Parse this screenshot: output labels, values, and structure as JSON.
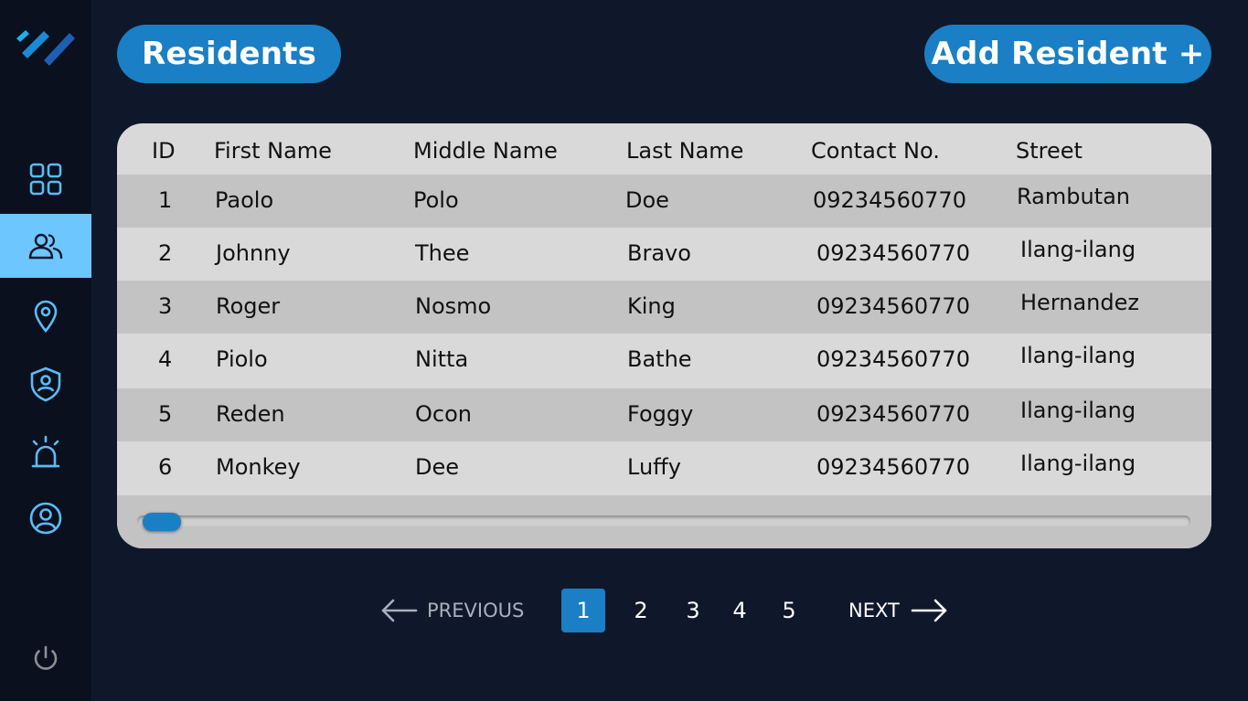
{
  "header": {
    "title": "Residents",
    "add_button": "Add Resident +"
  },
  "sidebar": {
    "items": [
      {
        "icon": "grid-icon",
        "active": false
      },
      {
        "icon": "users-icon",
        "active": true
      },
      {
        "icon": "map-pin-icon",
        "active": false
      },
      {
        "icon": "shield-user-icon",
        "active": false
      },
      {
        "icon": "alarm-icon",
        "active": false
      },
      {
        "icon": "user-circle-icon",
        "active": false
      }
    ],
    "power_icon": "power-icon"
  },
  "table": {
    "columns": [
      "ID",
      "First Name",
      "Middle Name",
      "Last Name",
      "Contact No.",
      "Street"
    ],
    "rows": [
      [
        "1",
        "Paolo",
        "Polo",
        "Doe",
        "09234560770",
        "Rambutan"
      ],
      [
        "2",
        "Johnny",
        "Thee",
        "Bravo",
        "09234560770",
        "Ilang-ilang"
      ],
      [
        "3",
        "Roger",
        "Nosmo",
        "King",
        "09234560770",
        "Hernandez"
      ],
      [
        "4",
        "Piolo",
        "Nitta",
        "Bathe",
        "09234560770",
        "Ilang-ilang"
      ],
      [
        "5",
        "Reden",
        "Ocon",
        "Foggy",
        "09234560770",
        "Ilang-ilang"
      ],
      [
        "6",
        "Monkey",
        "Dee",
        "Luffy",
        "09234560770",
        "Ilang-ilang"
      ]
    ]
  },
  "pagination": {
    "previous": "PREVIOUS",
    "next": "NEXT",
    "pages": [
      "1",
      "2",
      "3",
      "4",
      "5"
    ],
    "current": "1"
  },
  "colors": {
    "background": "#0f182b",
    "sidebar": "#0a101e",
    "accent": "#1a7fc4",
    "active_nav": "#6ec6ff",
    "icon": "#5bbcf5"
  }
}
